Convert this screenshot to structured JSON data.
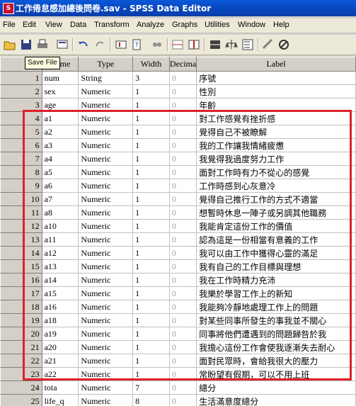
{
  "window": {
    "title": "工作倦怠感加總後問卷.sav - SPSS Data Editor"
  },
  "menu": [
    "File",
    "Edit",
    "View",
    "Data",
    "Transform",
    "Analyze",
    "Graphs",
    "Utilities",
    "Window",
    "Help"
  ],
  "toolbar": {
    "tooltip": "Save File",
    "icons": [
      "open-icon",
      "save-icon",
      "print-icon",
      "dialog-recall-icon",
      "undo-icon",
      "redo-icon",
      "goto-case-icon",
      "variables-icon",
      "find-icon",
      "insert-case-icon",
      "insert-variable-icon",
      "split-file-icon",
      "weight-cases-icon",
      "select-cases-icon",
      "value-labels-icon",
      "use-sets-icon"
    ]
  },
  "grid": {
    "columns": [
      "Name",
      "Type",
      "Width",
      "Decima",
      "Label"
    ],
    "rows": [
      {
        "n": "1",
        "name": "num",
        "type": "String",
        "width": "3",
        "dec": "0",
        "label": "序號"
      },
      {
        "n": "2",
        "name": "sex",
        "type": "Numeric",
        "width": "1",
        "dec": "0",
        "label": "性別"
      },
      {
        "n": "3",
        "name": "age",
        "type": "Numeric",
        "width": "1",
        "dec": "0",
        "label": "年齡"
      },
      {
        "n": "4",
        "name": "a1",
        "type": "Numeric",
        "width": "1",
        "dec": "0",
        "label": "對工作感覺有挫折感"
      },
      {
        "n": "5",
        "name": "a2",
        "type": "Numeric",
        "width": "1",
        "dec": "0",
        "label": "覺得自己不被瞭解"
      },
      {
        "n": "6",
        "name": "a3",
        "type": "Numeric",
        "width": "1",
        "dec": "0",
        "label": "我的工作讓我情緒疲憊"
      },
      {
        "n": "7",
        "name": "a4",
        "type": "Numeric",
        "width": "1",
        "dec": "0",
        "label": "我覺得我過度努力工作"
      },
      {
        "n": "8",
        "name": "a5",
        "type": "Numeric",
        "width": "1",
        "dec": "0",
        "label": "面對工作時有力不從心的感覺"
      },
      {
        "n": "9",
        "name": "a6",
        "type": "Numeric",
        "width": "1",
        "dec": "0",
        "label": "工作時感到心灰意冷"
      },
      {
        "n": "10",
        "name": "a7",
        "type": "Numeric",
        "width": "1",
        "dec": "0",
        "label": "覺得自己推行工作的方式不適當"
      },
      {
        "n": "11",
        "name": "a8",
        "type": "Numeric",
        "width": "1",
        "dec": "0",
        "label": "想暫時休息一陣子或另調其他職務"
      },
      {
        "n": "12",
        "name": "a10",
        "type": "Numeric",
        "width": "1",
        "dec": "0",
        "label": "我能肯定這份工作的價值"
      },
      {
        "n": "13",
        "name": "a11",
        "type": "Numeric",
        "width": "1",
        "dec": "0",
        "label": "認為這是一份相當有意義的工作"
      },
      {
        "n": "14",
        "name": "a12",
        "type": "Numeric",
        "width": "1",
        "dec": "0",
        "label": "我可以由工作中獲得心靈的滿足"
      },
      {
        "n": "15",
        "name": "a13",
        "type": "Numeric",
        "width": "1",
        "dec": "0",
        "label": "我有自己的工作目標與理想"
      },
      {
        "n": "16",
        "name": "a14",
        "type": "Numeric",
        "width": "1",
        "dec": "0",
        "label": "我在工作時精力充沛"
      },
      {
        "n": "17",
        "name": "a15",
        "type": "Numeric",
        "width": "1",
        "dec": "0",
        "label": "我樂於學習工作上的新知"
      },
      {
        "n": "18",
        "name": "a16",
        "type": "Numeric",
        "width": "1",
        "dec": "0",
        "label": "我能夠冷靜地處理工作上的問題"
      },
      {
        "n": "19",
        "name": "a18",
        "type": "Numeric",
        "width": "1",
        "dec": "0",
        "label": "對某些同事所發生的事我並不關心"
      },
      {
        "n": "20",
        "name": "a19",
        "type": "Numeric",
        "width": "1",
        "dec": "0",
        "label": "同事將他們遭遇到的問題歸咎於我"
      },
      {
        "n": "21",
        "name": "a20",
        "type": "Numeric",
        "width": "1",
        "dec": "0",
        "label": "我擔心這份工作會使我逐漸失去耐心"
      },
      {
        "n": "22",
        "name": "a21",
        "type": "Numeric",
        "width": "1",
        "dec": "0",
        "label": "面對民眾時，會給我很大的壓力"
      },
      {
        "n": "23",
        "name": "a22",
        "type": "Numeric",
        "width": "1",
        "dec": "0",
        "label": "常盼望有假期，可以不用上班"
      },
      {
        "n": "24",
        "name": "tota",
        "type": "Numeric",
        "width": "7",
        "dec": "0",
        "label": "總分"
      },
      {
        "n": "25",
        "name": "life_q",
        "type": "Numeric",
        "width": "8",
        "dec": "0",
        "label": "生活滿意度總分"
      }
    ]
  },
  "highlight_color": "#e0202c"
}
